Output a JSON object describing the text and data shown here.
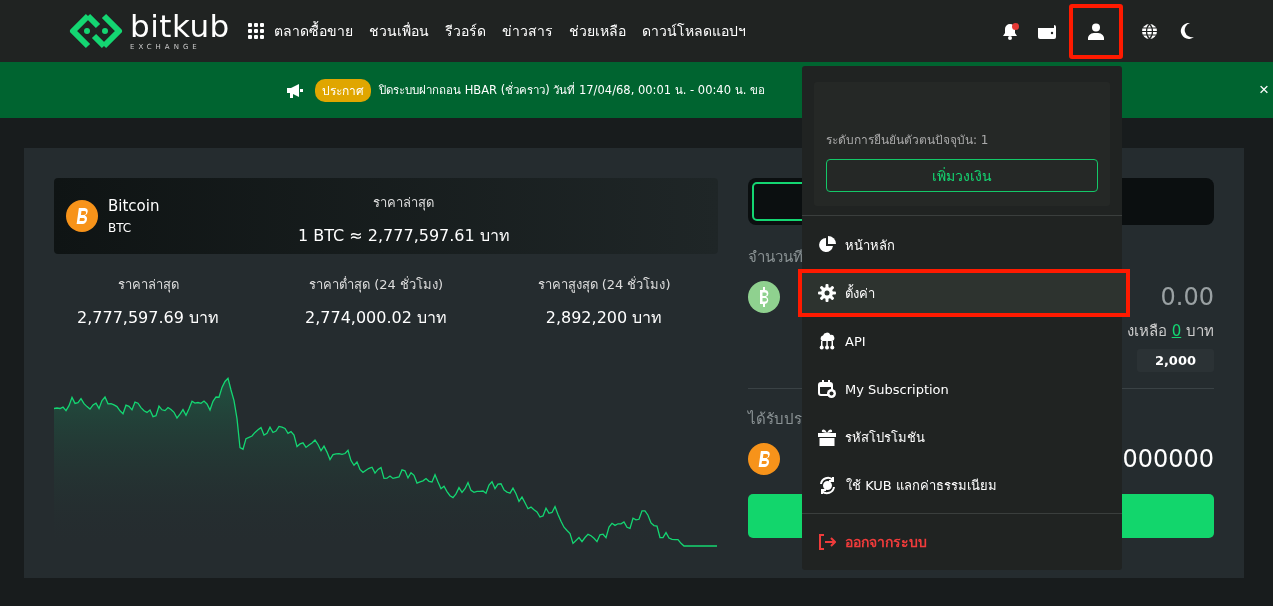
{
  "header": {
    "logo_name": "bitkub",
    "logo_sub": "EXCHANGE",
    "nav": [
      "ตลาดซื้อขาย",
      "ชวนเพื่อน",
      "รีวอร์ด",
      "ข่าวสาร",
      "ช่วยเหลือ",
      "ดาวน์โหลดแอปฯ"
    ],
    "icons": [
      {
        "kind": "bell",
        "badge": true,
        "highlighted": false
      },
      {
        "kind": "wallet",
        "highlighted": false
      },
      {
        "kind": "user",
        "highlighted": true
      },
      {
        "kind": "globe",
        "highlighted": false
      },
      {
        "kind": "moon",
        "highlighted": false
      }
    ]
  },
  "announcement": {
    "badge": "ประกาศ",
    "text": "ปิดระบบฝากถอน HBAR (ชั่วคราว) วันที่ 17/04/68, 00:01 น. - 00:40 น. ขอ",
    "close": "×"
  },
  "coin": {
    "name": "Bitcoin",
    "symbol": "BTC",
    "price_label": "ราคาล่าสุด",
    "price": "1 BTC ≈ 2,777,597.61 บาท"
  },
  "stats": [
    {
      "label": "ราคาล่าสุด",
      "value": "2,777,597.69 บาท"
    },
    {
      "label": "ราคาต่ำสุด (24 ชั่วโมง)",
      "value": "2,774,000.02 บาท"
    },
    {
      "label": "ราคาสูงสุด (24 ชั่วโมง)",
      "value": "2,892,200 บาท"
    }
  ],
  "trade": {
    "tabs": [
      {
        "selected": true
      }
    ],
    "amount_label": "จำนวนที",
    "pay_value": "0.00",
    "balance_prefix": "งเหลือ",
    "balance_link": "0",
    "balance_suffix": "บาท",
    "chip": "2,000",
    "receive_label": "ได้รับปร",
    "receive_value": "000000"
  },
  "dropdown": {
    "verify_text": "ระดับการยืนยันตัวตนปัจจุบัน: 1",
    "limit_button": "เพิ่มวงเงิน",
    "items": [
      {
        "kind": "pie",
        "label": "หน้าหลัก",
        "selected": false,
        "highlighted": false
      },
      {
        "kind": "gear",
        "label": "ตั้งค่า",
        "selected": true,
        "highlighted": true
      },
      {
        "kind": "cloud",
        "label": "API",
        "selected": false,
        "highlighted": false
      },
      {
        "kind": "calendar",
        "label": "My Subscription",
        "selected": false,
        "highlighted": false
      },
      {
        "kind": "gift",
        "label": "รหัสโปรโมชัน",
        "selected": false,
        "highlighted": false
      },
      {
        "kind": "swap",
        "label": "ใช้ KUB แลกค่าธรรมเนียม",
        "selected": false,
        "highlighted": false
      }
    ],
    "logout": "ออกจากระบบ"
  }
}
